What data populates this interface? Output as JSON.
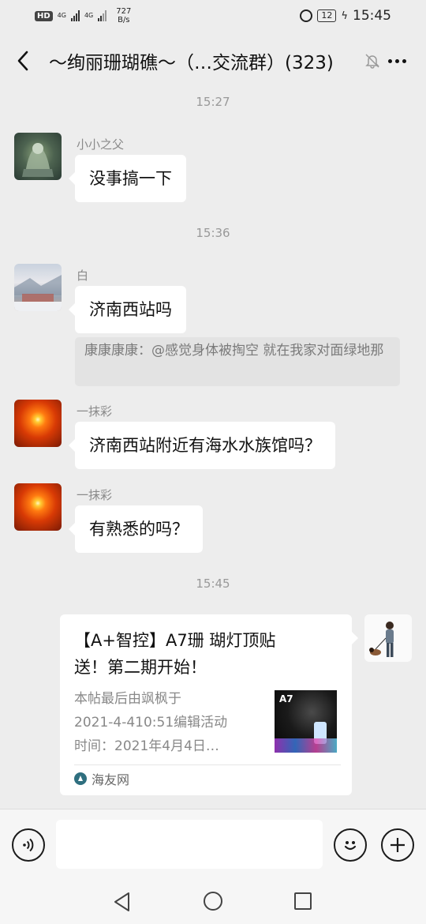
{
  "status_bar": {
    "hd": "HD",
    "net1": "4G",
    "net2": "4G",
    "speed_value": "727",
    "speed_unit": "B/s",
    "battery": "12",
    "time": "15:45"
  },
  "nav": {
    "title": "～绚丽珊瑚礁～（…交流群）(323)"
  },
  "messages": [
    {
      "time": "15:27",
      "sender": "小小之父",
      "text": "没事搞一下"
    },
    {
      "time": "15:36",
      "sender": "白",
      "text": "济南西站吗",
      "quote": "康康康康：@感觉身体被掏空 就在我家对面绿地那"
    },
    {
      "sender": "一抹彩",
      "text": "济南西站附近有海水水族馆吗？"
    },
    {
      "sender": "一抹彩",
      "text": "有熟悉的吗？"
    }
  ],
  "card": {
    "time": "15:45",
    "title_line1": "【A+智控】A7珊 瑚灯顶贴",
    "title_line2": "送！第二期开始！",
    "desc_line1": "本帖最后由飒枫于",
    "desc_line2": "2021-4-410:51编辑活动",
    "desc_line3": "时间：2021年4月4日…",
    "thumb_label": "A7",
    "source": "海友网"
  },
  "icons": {
    "back": "chevron-left-icon",
    "mute": "bell-off-icon",
    "more": "more-dots-icon",
    "voice": "voice-icon",
    "emoji": "emoji-icon",
    "plus": "plus-icon"
  }
}
